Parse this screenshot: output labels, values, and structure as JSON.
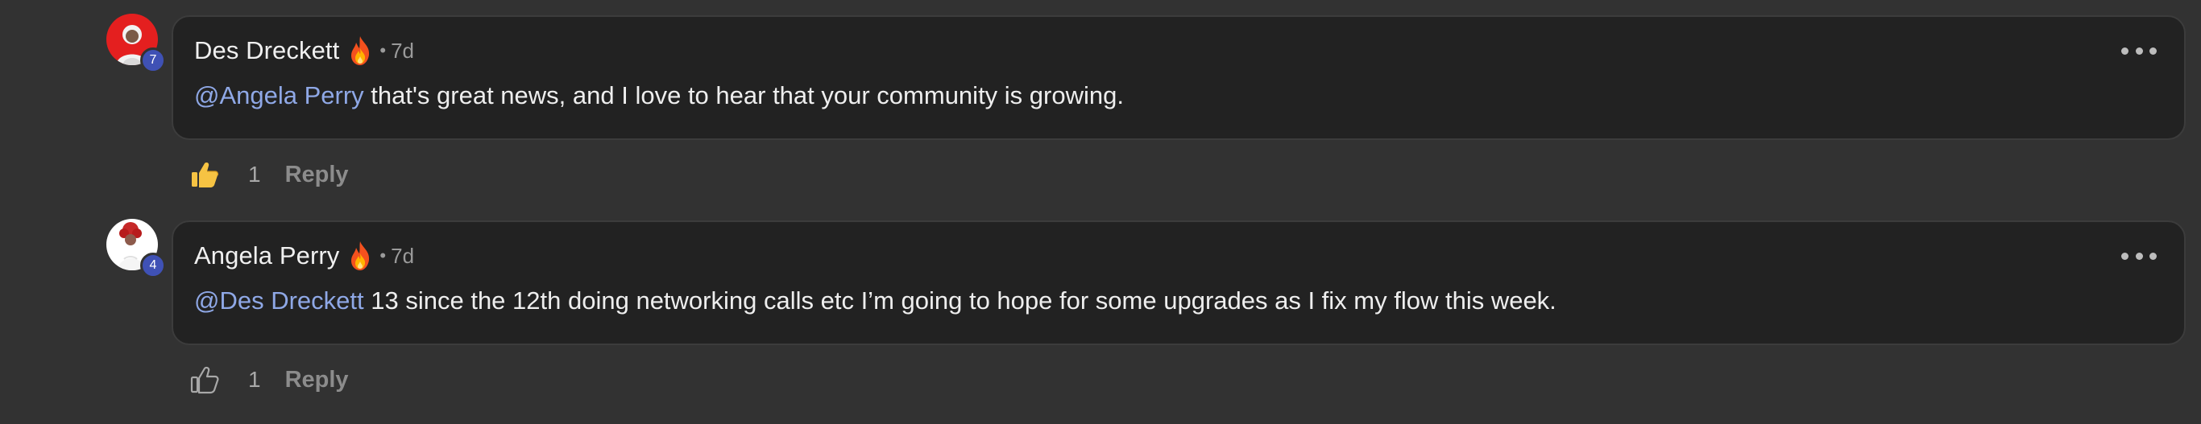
{
  "comments": [
    {
      "author": "Des Dreckett",
      "level": "7",
      "separator": "•",
      "time": "7d",
      "mention": "@Angela Perry",
      "text": " that's great news, and I love to hear that your community is growing.",
      "likes": "1",
      "reply_label": "Reply",
      "liked": true,
      "avatar_bg": "#e41f1f"
    },
    {
      "author": "Angela Perry",
      "level": "4",
      "separator": "•",
      "time": "7d",
      "mention": "@Des Dreckett",
      "text": " 13 since the 12th doing networking calls etc I’m going to hope for some upgrades as I fix my flow this week.",
      "likes": "1",
      "reply_label": "Reply",
      "liked": false,
      "avatar_bg": "#ffffff"
    }
  ],
  "colors": {
    "page_bg": "#323232",
    "bubble_bg": "#222222",
    "mention": "#8fa8e6",
    "badge": "#3f51b5"
  }
}
